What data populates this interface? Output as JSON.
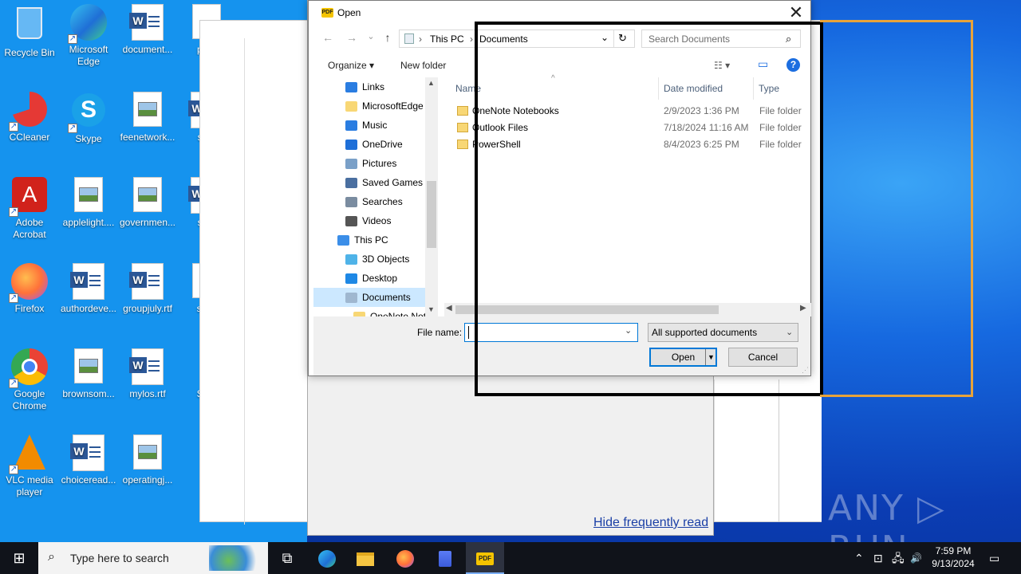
{
  "desktop_icons": [
    {
      "label": "Recycle Bin",
      "label2": ""
    },
    {
      "label": "Microsoft",
      "label2": "Edge"
    },
    {
      "label": "document...",
      "label2": ""
    },
    {
      "label": "prod",
      "label2": ""
    },
    {
      "label": "CCleaner",
      "label2": ""
    },
    {
      "label": "Skype",
      "label2": ""
    },
    {
      "label": "feenetwork...",
      "label2": ""
    },
    {
      "label": "som",
      "label2": ""
    },
    {
      "label": "Adobe",
      "label2": "Acrobat"
    },
    {
      "label": "applelight....",
      "label2": ""
    },
    {
      "label": "governmen...",
      "label2": ""
    },
    {
      "label": "som",
      "label2": ""
    },
    {
      "label": "Firefox",
      "label2": ""
    },
    {
      "label": "authordeve...",
      "label2": ""
    },
    {
      "label": "groupjuly.rtf",
      "label2": ""
    },
    {
      "label": "succ",
      "label2": ""
    },
    {
      "label": "Google",
      "label2": "Chrome"
    },
    {
      "label": "brownsom...",
      "label2": ""
    },
    {
      "label": "mylos.rtf",
      "label2": ""
    },
    {
      "label": "Sum",
      "label2": ""
    },
    {
      "label": "VLC media",
      "label2": "player"
    },
    {
      "label": "choiceread...",
      "label2": ""
    },
    {
      "label": "operatingj...",
      "label2": ""
    }
  ],
  "background_app": {
    "link": "Hide frequently read"
  },
  "dialog": {
    "title": "Open",
    "close": "✕",
    "nav": {
      "back": "←",
      "forward": "→",
      "recent": "⌄",
      "up": "↑",
      "refresh": "↻"
    },
    "address": {
      "crumb1": "This PC",
      "crumb2": "Documents",
      "dropdown": "⌄"
    },
    "search_placeholder": "Search Documents",
    "toolbar": {
      "organize": "Organize ▾",
      "new_folder": "New folder",
      "view": "☷ ▾",
      "preview": "▭",
      "help": "?"
    },
    "tree": [
      {
        "label": "Links",
        "icon": "links",
        "color": "#2a7de1",
        "indent": 1
      },
      {
        "label": "MicrosoftEdge",
        "icon": "folder",
        "color": "#f8d775",
        "indent": 1
      },
      {
        "label": "Music",
        "icon": "music",
        "color": "#2a7de1",
        "indent": 1
      },
      {
        "label": "OneDrive",
        "icon": "onedrive",
        "color": "#1e6fd8",
        "indent": 1
      },
      {
        "label": "Pictures",
        "icon": "pictures",
        "color": "#7aa0c8",
        "indent": 1
      },
      {
        "label": "Saved Games",
        "icon": "saved-games",
        "color": "#4a6fa0",
        "indent": 1
      },
      {
        "label": "Searches",
        "icon": "searches",
        "color": "#7a8ca0",
        "indent": 1
      },
      {
        "label": "Videos",
        "icon": "videos",
        "color": "#555555",
        "indent": 1
      },
      {
        "label": "This PC",
        "icon": "this-pc",
        "color": "#3b8ee8",
        "indent": 0
      },
      {
        "label": "3D Objects",
        "icon": "3d-objects",
        "color": "#4fb3e8",
        "indent": 1
      },
      {
        "label": "Desktop",
        "icon": "desktop",
        "color": "#1e88e5",
        "indent": 1
      },
      {
        "label": "Documents",
        "icon": "documents",
        "color": "#9fb7d0",
        "indent": 1
      },
      {
        "label": "OneNote Not",
        "icon": "folder",
        "color": "#f8d775",
        "indent": 2
      }
    ],
    "columns": {
      "name": "Name",
      "date": "Date modified",
      "type": "Type"
    },
    "files": [
      {
        "name": "OneNote Notebooks",
        "date": "2/9/2023 1:36 PM",
        "type": "File folder"
      },
      {
        "name": "Outlook Files",
        "date": "7/18/2024 11:16 AM",
        "type": "File folder"
      },
      {
        "name": "PowerShell",
        "date": "8/4/2023 6:25 PM",
        "type": "File folder"
      }
    ],
    "file_name_label": "File name:",
    "file_name_value": "",
    "file_type": "All supported documents",
    "open": "Open",
    "cancel": "Cancel"
  },
  "watermark": "ANY ▷ RUN",
  "taskbar": {
    "start": "⊞",
    "search_placeholder": "Type here to search",
    "search_icon": "⌕",
    "apps": [
      "task-view",
      "edge",
      "file-explorer",
      "firefox",
      "app",
      "pdf-reader"
    ],
    "tray": {
      "chevron": "⌃",
      "net": "⊡",
      "vol": "🔊",
      "notif": "▭"
    },
    "time": "7:59 PM",
    "date": "9/13/2024"
  },
  "colors": {
    "accent": "#0078d7",
    "highlight_orange": "#e8a33a",
    "selection": "#cce8ff"
  }
}
